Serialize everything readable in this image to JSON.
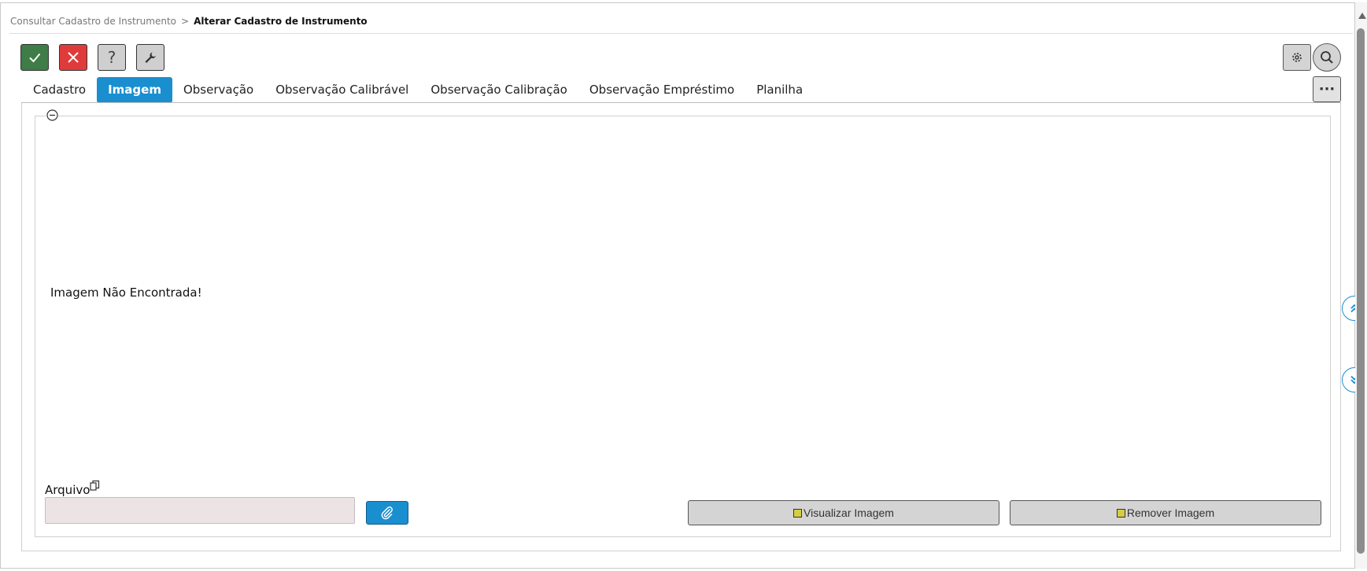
{
  "breadcrumb": {
    "parent": "Consultar Cadastro de Instrumento",
    "separator": ">",
    "current": "Alterar Cadastro de Instrumento"
  },
  "toolbar": {
    "confirm_icon": "check-icon",
    "cancel_icon": "close-icon",
    "help_label": "?",
    "tool_icon": "wrench-icon",
    "settings_icon": "gear-icon",
    "search_icon": "search-icon",
    "more_label": "···"
  },
  "tabs": [
    {
      "label": "Cadastro",
      "active": false
    },
    {
      "label": "Imagem",
      "active": true
    },
    {
      "label": "Observação",
      "active": false
    },
    {
      "label": "Observação Calibrável",
      "active": false
    },
    {
      "label": "Observação Calibração",
      "active": false
    },
    {
      "label": "Observação Empréstimo",
      "active": false
    },
    {
      "label": "Planilha",
      "active": false
    }
  ],
  "image_panel": {
    "collapse_icon": "minus-circle-icon",
    "message": "Imagem Não Encontrada!"
  },
  "file": {
    "label": "Arquivo",
    "copy_icon": "copy-icon",
    "value": "",
    "attach_icon": "paperclip-icon"
  },
  "actions": {
    "view_label": "Visualizar Imagem",
    "remove_label": "Remover Imagem"
  },
  "colors": {
    "accent": "#1a8fd0",
    "confirm": "#3e7d48",
    "cancel": "#e03b3b"
  }
}
